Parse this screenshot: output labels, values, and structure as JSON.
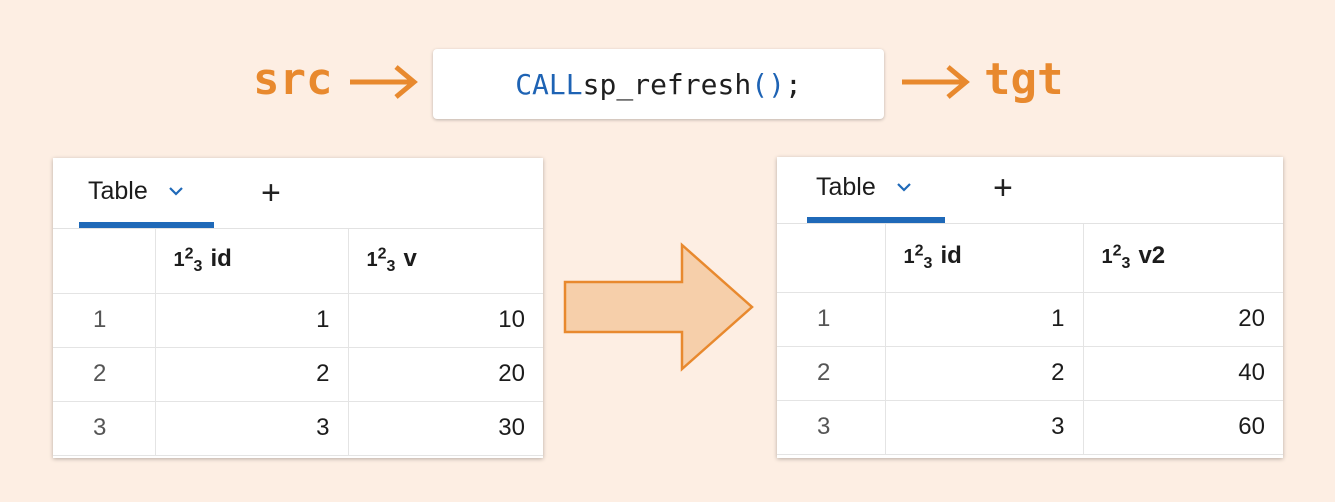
{
  "header": {
    "src_label": "src",
    "tgt_label": "tgt",
    "code": {
      "keyword": "CALL",
      "name": " sp_refresh",
      "open_paren": "(",
      "close_paren": ")",
      "semicolon": ";"
    }
  },
  "source_table": {
    "tab_label": "Table",
    "columns": [
      {
        "label": "id",
        "type_icon": [
          "1",
          "2",
          "3"
        ]
      },
      {
        "label": "v",
        "type_icon": [
          "1",
          "2",
          "3"
        ]
      }
    ],
    "rows": [
      {
        "num": "1",
        "cells": [
          "1",
          "10"
        ]
      },
      {
        "num": "2",
        "cells": [
          "2",
          "20"
        ]
      },
      {
        "num": "3",
        "cells": [
          "3",
          "30"
        ]
      }
    ]
  },
  "target_table": {
    "tab_label": "Table",
    "columns": [
      {
        "label": "id",
        "type_icon": [
          "1",
          "2",
          "3"
        ]
      },
      {
        "label": "v2",
        "type_icon": [
          "1",
          "2",
          "3"
        ]
      }
    ],
    "rows": [
      {
        "num": "1",
        "cells": [
          "1",
          "20"
        ]
      },
      {
        "num": "2",
        "cells": [
          "2",
          "40"
        ]
      },
      {
        "num": "3",
        "cells": [
          "3",
          "60"
        ]
      }
    ]
  },
  "colors": {
    "accent_orange": "#e8892e",
    "arrow_fill": "#f6cfaa",
    "tab_blue": "#1f69b8",
    "background": "#fdeee3"
  }
}
